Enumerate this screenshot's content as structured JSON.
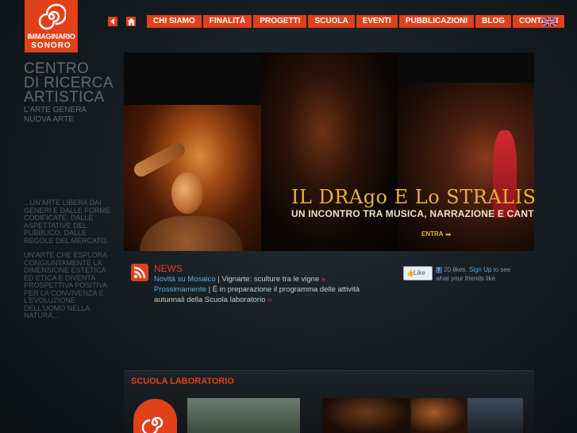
{
  "brand": {
    "logo_line1": "IMMAGINARIO",
    "logo_line2": "SONORO",
    "accent": "#e0401a"
  },
  "nav": {
    "back_icon": "back-arrow-icon",
    "home_icon": "home-icon",
    "items": [
      "CHI SIAMO",
      "FINALITÀ",
      "PROGETTI",
      "SCUOLA",
      "EVENTI",
      "PUBBLICAZIONI",
      "BLOG",
      "CONTATTI"
    ],
    "language_icon": "uk-flag-icon"
  },
  "tagline": {
    "line1": "CENTRO",
    "line2": "DI RICERCA",
    "line3": "ARTISTICA",
    "sub1": "L'ARTE GENERA",
    "sub2": "NUOVA ARTE"
  },
  "manifesto": {
    "p1": "...UN'ARTE LIBERA DAI GENERI E DALLE FORME CODIFICATE, DALLE ASPETTATIVE DEL PUBBLICO, DALLE REGOLE DEL MERCATO.",
    "p2": "UN'ARTE CHE ESPLORA CONGIUNTAMENTE LA DIMENSIONE ESTETICA ED ETICA E DIVENTA PROSPETTIVA POSITIVA PER LA CONVIVENZA E L'EVOLUZIONE DELL'UOMO NELLA NATURA..."
  },
  "hero": {
    "title": "IL DRAgo E Lo STRALISCO",
    "subtitle": "UN INCONTRO TRA MUSICA, NARRAZIONE E CANTO",
    "enter_label": "ENTRA"
  },
  "news": {
    "title": "NEWS",
    "link1": "Novità su Mosaico",
    "sep1": " | ",
    "text1": "Vignarte: sculture tra le vigne ",
    "link2": "Prossimamente",
    "sep2": " | ",
    "text2": "È in preparazione il programma delle attività autunnali della Scuola laboratorio ",
    "arrow": "»"
  },
  "facebook": {
    "like_label": "Like",
    "count_text": "20 likes.",
    "signup_label": "Sign Up",
    "tail_text": "to see what your friends like."
  },
  "scuola": {
    "title": "SCUOLA LABORATORIO"
  }
}
